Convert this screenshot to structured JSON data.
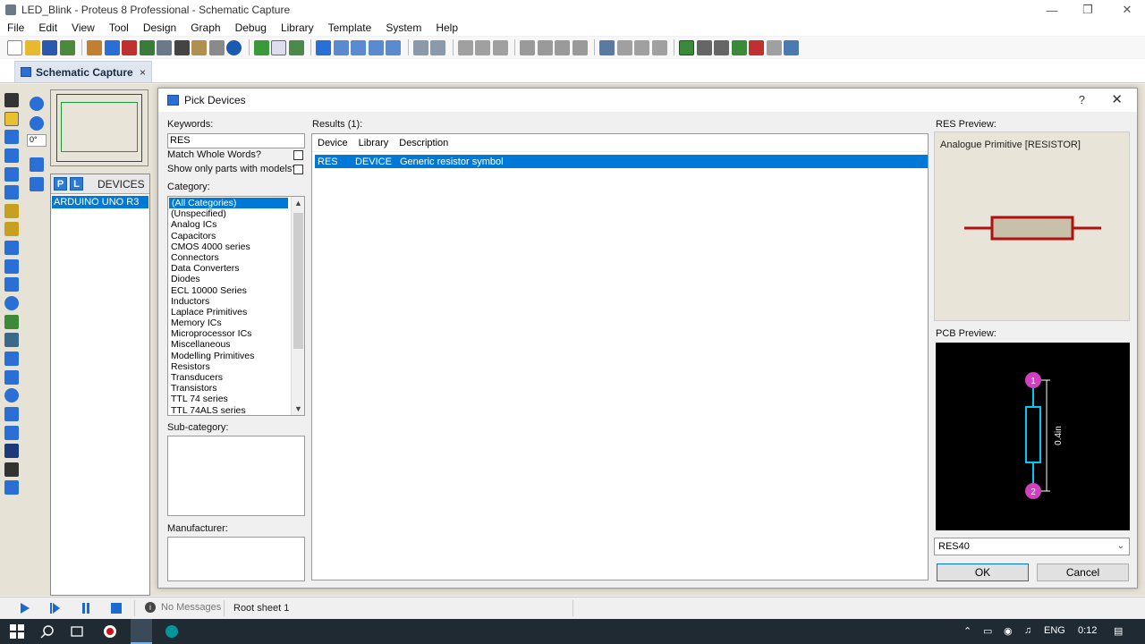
{
  "window": {
    "title": "LED_Blink - Proteus 8 Professional - Schematic Capture"
  },
  "menu": [
    "File",
    "Edit",
    "View",
    "Tool",
    "Design",
    "Graph",
    "Debug",
    "Library",
    "Template",
    "System",
    "Help"
  ],
  "tab": {
    "label": "Schematic Capture",
    "close": "×"
  },
  "left_panel": {
    "rotation_value": "0°",
    "pick_p": "P",
    "pick_l": "L",
    "devices_label": "DEVICES",
    "devices": [
      "ARDUINO UNO R3"
    ]
  },
  "dialog": {
    "title": "Pick Devices",
    "help": "?",
    "close": "✕",
    "keywords_label": "Keywords:",
    "keywords_value": "RES",
    "match_whole_words": "Match Whole Words?",
    "show_only_models": "Show only parts with models?",
    "category_label": "Category:",
    "categories": [
      "(All Categories)",
      "(Unspecified)",
      "Analog ICs",
      "Capacitors",
      "CMOS 4000 series",
      "Connectors",
      "Data Converters",
      "Diodes",
      "ECL 10000 Series",
      "Inductors",
      "Laplace Primitives",
      "Memory ICs",
      "Microprocessor ICs",
      "Miscellaneous",
      "Modelling Primitives",
      "Resistors",
      "Transducers",
      "Transistors",
      "TTL 74 series",
      "TTL 74ALS series"
    ],
    "subcategory_label": "Sub-category:",
    "manufacturer_label": "Manufacturer:",
    "results_label": "Results (1):",
    "columns": [
      "Device",
      "Library",
      "Description"
    ],
    "results": [
      {
        "device": "RES",
        "library": "DEVICE",
        "description": "Generic resistor symbol"
      }
    ],
    "preview_label": "RES Preview:",
    "preview_text": "Analogue Primitive [RESISTOR]",
    "pcb_label": "PCB Preview:",
    "pcb_pin1": "1",
    "pcb_pin2": "2",
    "pcb_dim": "0.4in",
    "package": "RES40",
    "ok": "OK",
    "cancel": "Cancel"
  },
  "status": {
    "message": "No Messages",
    "sheet": "Root sheet 1"
  },
  "taskbar": {
    "lang": "ENG",
    "time": "0:12"
  },
  "colors": {
    "accent": "#0078d7",
    "sheet_bg": "#e7e2d6",
    "resistor": "#b01010",
    "pcb_trace": "#00c8f0",
    "pcb_pad": "#d040c0"
  }
}
